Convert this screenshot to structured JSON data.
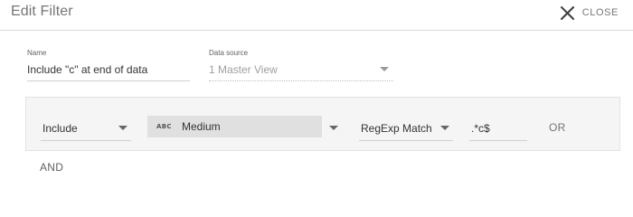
{
  "header": {
    "title": "Edit Filter",
    "close_label": "CLOSE"
  },
  "name_field": {
    "label": "Name",
    "value": "Include \"c\" at end of data"
  },
  "data_source": {
    "label": "Data source",
    "value": "1 Master View"
  },
  "condition": {
    "mode": "Include",
    "dimension_icon_text": "ABC",
    "dimension": "Medium",
    "match_type": "RegExp Match",
    "expression": ".*c$",
    "or_label": "OR"
  },
  "and_label": "AND",
  "colors": {
    "header_text": "#757575",
    "condition_bg": "#f5f5f5",
    "chip_bg": "#e0e0e0",
    "disabled_text": "#9e9e9e"
  },
  "icons": {
    "close": "close-icon",
    "dropdown": "caret-down-icon",
    "dimension_type": "abc-text-icon"
  }
}
